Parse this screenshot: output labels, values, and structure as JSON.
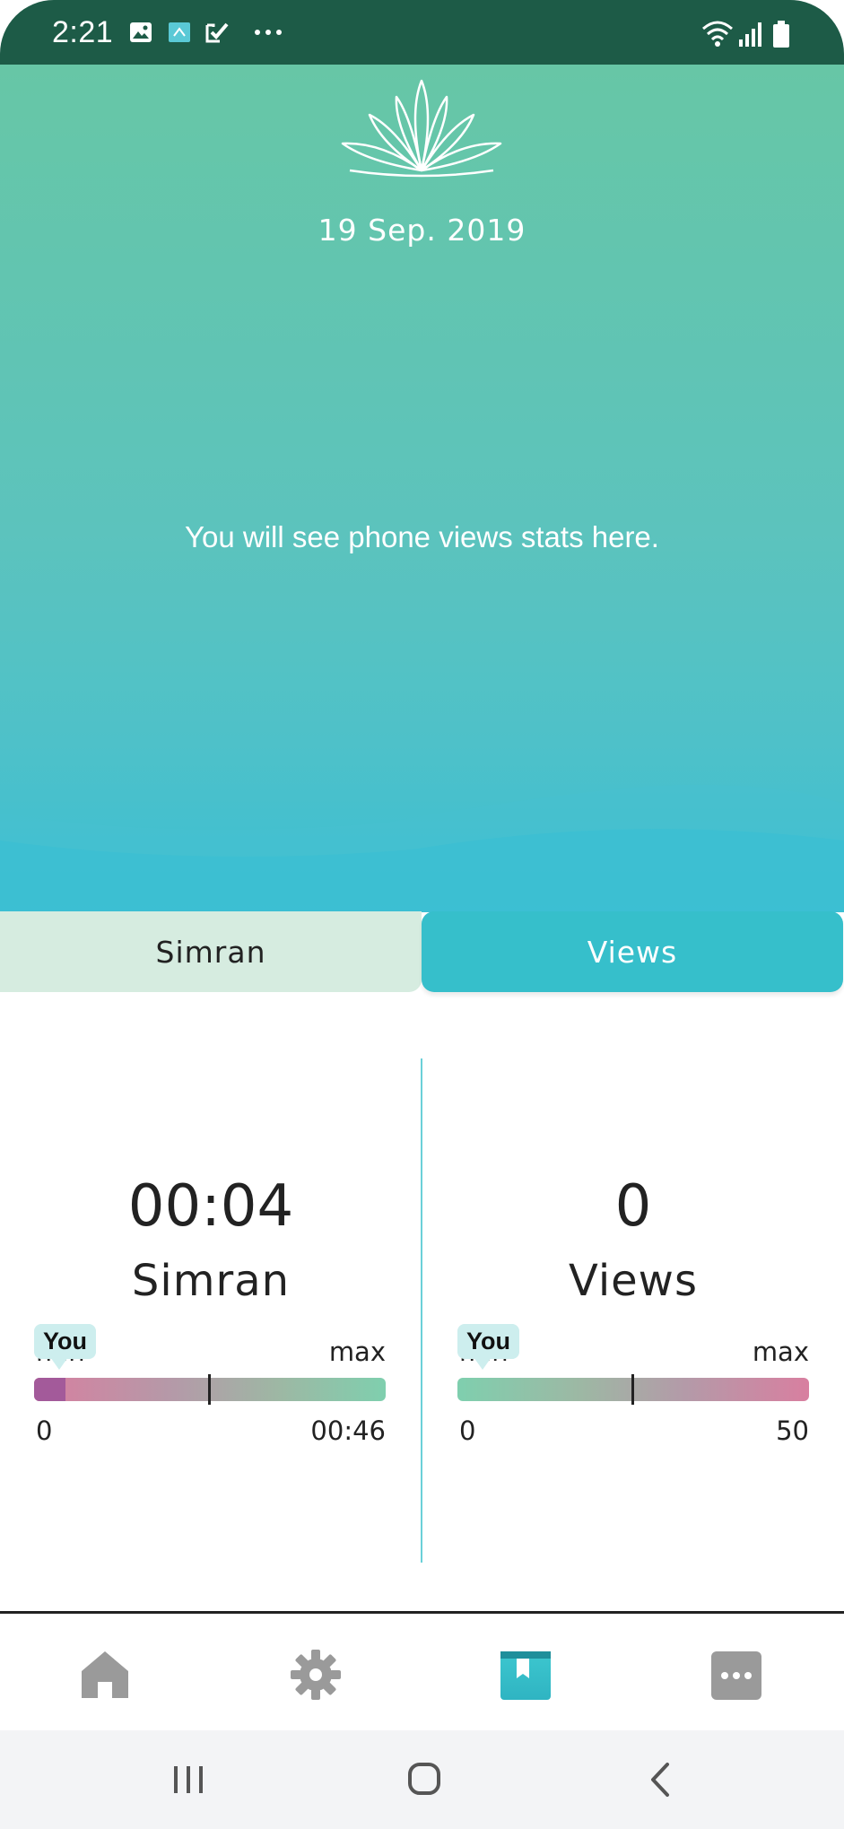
{
  "status_bar": {
    "time": "2:21",
    "icons": [
      "image-icon",
      "app-icon",
      "check-icon",
      "more-dots-icon",
      "wifi-icon",
      "signal-icon",
      "battery-icon"
    ]
  },
  "hero": {
    "logo": "lotus-logo",
    "date": "19 Sep. 2019",
    "message": "You will see phone views stats here."
  },
  "tabs": [
    {
      "label": "Simran",
      "active": false
    },
    {
      "label": "Views",
      "active": true
    }
  ],
  "stats": {
    "simran": {
      "value": "00:04",
      "label": "Simran",
      "range_min_label": "min",
      "range_max_label": "max",
      "range_min_value": "0",
      "range_max_value": "00:46",
      "you_label": "You",
      "you_fraction": 0.09
    },
    "views": {
      "value": "0",
      "label": "Views",
      "range_min_label": "min",
      "range_max_label": "max",
      "range_min_value": "0",
      "range_max_value": "50",
      "you_label": "You",
      "you_fraction": 0.0
    }
  },
  "bottom_nav": {
    "items": [
      {
        "icon": "home-icon",
        "active": false
      },
      {
        "icon": "gear-icon",
        "active": false
      },
      {
        "icon": "book-icon",
        "active": true
      },
      {
        "icon": "more-icon",
        "active": false
      }
    ]
  },
  "system_nav": [
    "recents-icon",
    "home-circle-icon",
    "back-icon"
  ],
  "colors": {
    "status_bar": "#1d5b47",
    "hero_top": "#67c6a6",
    "hero_bottom": "#3bbfd3",
    "tab_inactive": "#d6ece0",
    "tab_active": "#36bfcb",
    "you_marker": "#a35a9a"
  }
}
